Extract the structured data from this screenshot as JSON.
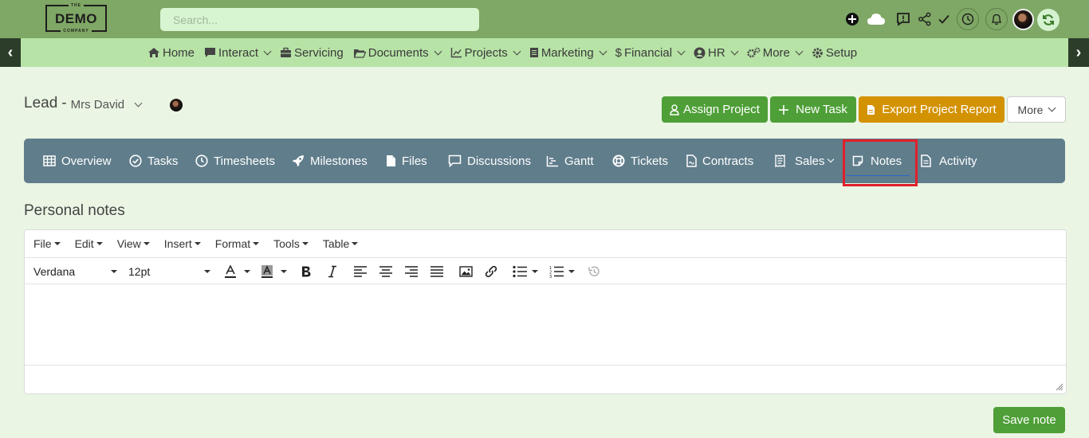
{
  "brand": {
    "logo_top": "THE",
    "logo_main": "DEMO",
    "logo_bottom": "COMPANY"
  },
  "search": {
    "placeholder": "Search..."
  },
  "nav": {
    "prev": "‹",
    "next": "›",
    "items": [
      {
        "label": "Home",
        "icon": "home-icon",
        "dropdown": false
      },
      {
        "label": "Interact",
        "icon": "comment-icon",
        "dropdown": true
      },
      {
        "label": "Servicing",
        "icon": "briefcase-icon",
        "dropdown": false
      },
      {
        "label": "Documents",
        "icon": "folder-icon",
        "dropdown": true
      },
      {
        "label": "Projects",
        "icon": "chart-icon",
        "dropdown": true
      },
      {
        "label": "Marketing",
        "icon": "document-icon",
        "dropdown": true
      },
      {
        "label": "Financial",
        "icon": "dollar-icon",
        "dropdown": true
      },
      {
        "label": "HR",
        "icon": "user-circle-icon",
        "dropdown": true
      },
      {
        "label": "More",
        "icon": "cogs-icon",
        "dropdown": true
      },
      {
        "label": "Setup",
        "icon": "gear-icon",
        "dropdown": false
      }
    ]
  },
  "lead": {
    "label": "Lead",
    "separator": "-",
    "name": "Mrs David"
  },
  "actions": {
    "assign_project": "Assign Project",
    "new_task": "New Task",
    "export_report": "Export Project Report",
    "more": "More"
  },
  "tabs": [
    {
      "label": "Overview",
      "icon": "grid-icon"
    },
    {
      "label": "Tasks",
      "icon": "check-circle-icon"
    },
    {
      "label": "Timesheets",
      "icon": "clock-icon"
    },
    {
      "label": "Milestones",
      "icon": "rocket-icon"
    },
    {
      "label": "Files",
      "icon": "file-icon"
    },
    {
      "label": "Discussions",
      "icon": "comment-icon"
    },
    {
      "label": "Gantt",
      "icon": "chart-icon"
    },
    {
      "label": "Tickets",
      "icon": "lifebuoy-icon"
    },
    {
      "label": "Contracts",
      "icon": "contract-icon"
    },
    {
      "label": "Sales",
      "icon": "receipt-icon"
    },
    {
      "label": "Notes",
      "icon": "note-icon",
      "active": true
    },
    {
      "label": "Activity",
      "icon": "document-icon"
    }
  ],
  "notes": {
    "title": "Personal notes",
    "menus": [
      "File",
      "Edit",
      "View",
      "Insert",
      "Format",
      "Tools",
      "Table"
    ],
    "font_family": "Verdana",
    "font_size": "12pt",
    "save_label": "Save note"
  },
  "colors": {
    "topbar": "#7fa765",
    "navbar": "#b7e3a6",
    "tabs_bg": "#607d8b",
    "accent_green": "#4e9f37",
    "accent_orange": "#d39200",
    "highlight": "#e0202a"
  }
}
